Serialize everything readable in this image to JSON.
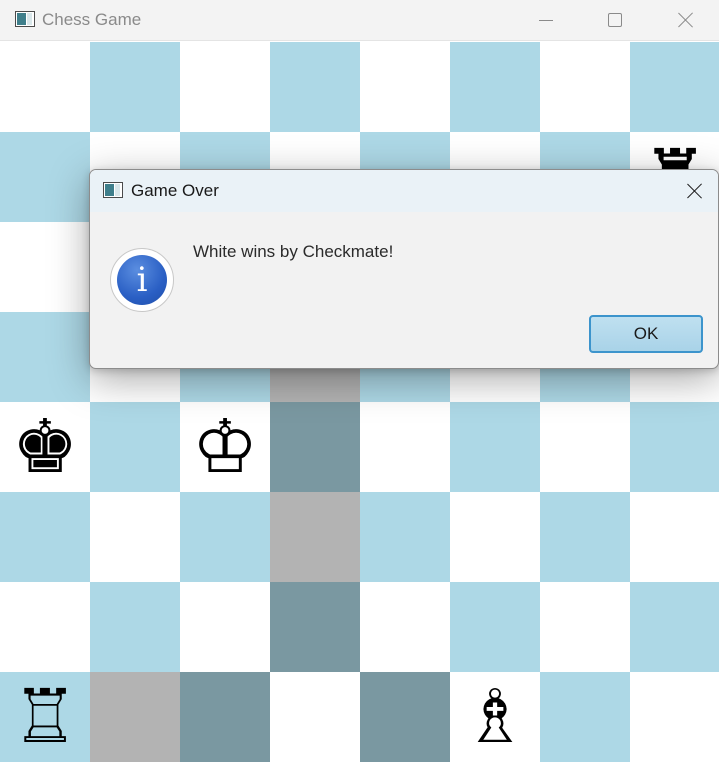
{
  "window": {
    "title": "Chess Game",
    "controls": [
      "minimize",
      "maximize",
      "close"
    ]
  },
  "board": {
    "rows": [
      [
        {
          "shade": "light",
          "piece": ""
        },
        {
          "shade": "dark",
          "piece": ""
        },
        {
          "shade": "light",
          "piece": ""
        },
        {
          "shade": "dark",
          "piece": ""
        },
        {
          "shade": "light",
          "piece": ""
        },
        {
          "shade": "dark",
          "piece": ""
        },
        {
          "shade": "light",
          "piece": ""
        },
        {
          "shade": "dark",
          "piece": ""
        }
      ],
      [
        {
          "shade": "dark",
          "piece": ""
        },
        {
          "shade": "light",
          "piece": ""
        },
        {
          "shade": "dark",
          "piece": ""
        },
        {
          "shade": "light",
          "piece": ""
        },
        {
          "shade": "dark",
          "piece": ""
        },
        {
          "shade": "light",
          "piece": ""
        },
        {
          "shade": "dark",
          "piece": ""
        },
        {
          "shade": "light",
          "piece": "♜"
        }
      ],
      [
        {
          "shade": "light",
          "piece": ""
        },
        {
          "shade": "dark",
          "piece": ""
        },
        {
          "shade": "light",
          "piece": ""
        },
        {
          "shade": "dark",
          "piece": ""
        },
        {
          "shade": "light",
          "piece": ""
        },
        {
          "shade": "dark",
          "piece": ""
        },
        {
          "shade": "light",
          "piece": ""
        },
        {
          "shade": "dark",
          "piece": ""
        }
      ],
      [
        {
          "shade": "dark",
          "piece": ""
        },
        {
          "shade": "light",
          "piece": ""
        },
        {
          "shade": "dark",
          "piece": ""
        },
        {
          "shade": "hl-light",
          "piece": ""
        },
        {
          "shade": "dark",
          "piece": ""
        },
        {
          "shade": "light",
          "piece": ""
        },
        {
          "shade": "dark",
          "piece": ""
        },
        {
          "shade": "light",
          "piece": ""
        }
      ],
      [
        {
          "shade": "light",
          "piece": "♚"
        },
        {
          "shade": "dark",
          "piece": ""
        },
        {
          "shade": "light",
          "piece": "♔"
        },
        {
          "shade": "hl-dark",
          "piece": ""
        },
        {
          "shade": "light",
          "piece": ""
        },
        {
          "shade": "dark",
          "piece": ""
        },
        {
          "shade": "light",
          "piece": ""
        },
        {
          "shade": "dark",
          "piece": ""
        }
      ],
      [
        {
          "shade": "dark",
          "piece": ""
        },
        {
          "shade": "light",
          "piece": ""
        },
        {
          "shade": "dark",
          "piece": ""
        },
        {
          "shade": "hl-light",
          "piece": ""
        },
        {
          "shade": "dark",
          "piece": ""
        },
        {
          "shade": "light",
          "piece": ""
        },
        {
          "shade": "dark",
          "piece": ""
        },
        {
          "shade": "light",
          "piece": ""
        }
      ],
      [
        {
          "shade": "light",
          "piece": ""
        },
        {
          "shade": "dark",
          "piece": ""
        },
        {
          "shade": "light",
          "piece": ""
        },
        {
          "shade": "hl-dark",
          "piece": ""
        },
        {
          "shade": "light",
          "piece": ""
        },
        {
          "shade": "dark",
          "piece": ""
        },
        {
          "shade": "light",
          "piece": ""
        },
        {
          "shade": "dark",
          "piece": ""
        }
      ],
      [
        {
          "shade": "dark",
          "piece": "♖"
        },
        {
          "shade": "hl-light",
          "piece": ""
        },
        {
          "shade": "hl-dark",
          "piece": ""
        },
        {
          "shade": "light",
          "piece": ""
        },
        {
          "shade": "hl-dark",
          "piece": ""
        },
        {
          "shade": "light",
          "piece": "♗"
        },
        {
          "shade": "dark",
          "piece": ""
        },
        {
          "shade": "light",
          "piece": ""
        }
      ]
    ],
    "colors": {
      "light": "#ffffff",
      "dark": "#add8e6",
      "highlight_dark": "#7a98a1",
      "highlight_light": "#b3b3b3"
    }
  },
  "dialog": {
    "title": "Game Over",
    "message": "White wins by Checkmate!",
    "icon": "info-icon",
    "icon_glyph": "i",
    "ok_label": "OK",
    "accent": "#3c94cc"
  }
}
